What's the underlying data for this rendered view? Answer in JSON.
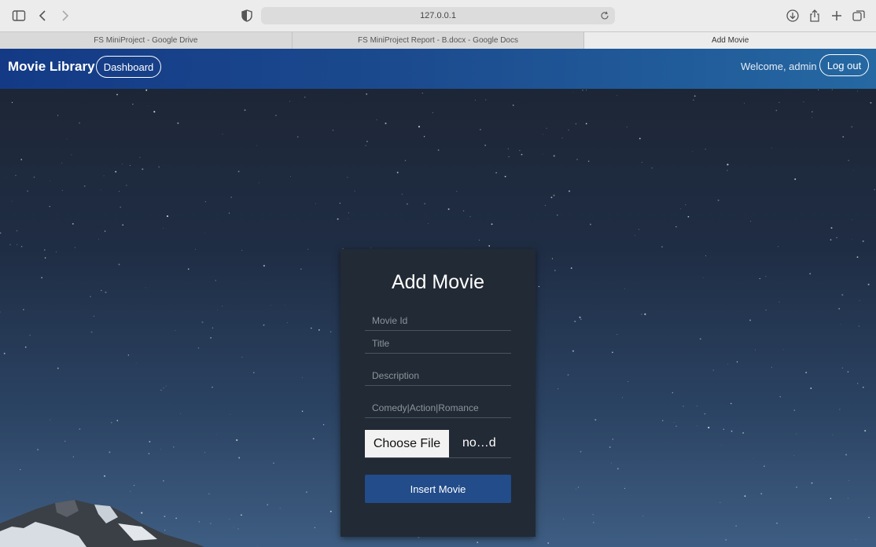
{
  "browser": {
    "address": "127.0.0.1",
    "tabs": [
      {
        "title": "FS MiniProject - Google Drive",
        "active": false
      },
      {
        "title": "FS MiniProject Report - B.docx - Google Docs",
        "active": false
      },
      {
        "title": "Add Movie",
        "active": true
      }
    ]
  },
  "header": {
    "brand": "Movie Library",
    "dashboard_label": "Dashboard",
    "welcome_text": "Welcome, admin",
    "logout_label": "Log out"
  },
  "form": {
    "title": "Add Movie",
    "movie_id": {
      "placeholder": "Movie Id",
      "value": ""
    },
    "title_field": {
      "placeholder": "Title",
      "value": ""
    },
    "description": {
      "placeholder": "Description",
      "value": ""
    },
    "genre": {
      "placeholder": "Comedy|Action|Romance",
      "value": ""
    },
    "file": {
      "button_label": "Choose File",
      "filename": "no…d"
    },
    "submit_label": "Insert Movie"
  },
  "colors": {
    "header_gradient_start": "#143a86",
    "header_gradient_end": "#2568a2",
    "card_bg": "#222a35",
    "submit_bg": "#224c8a"
  }
}
